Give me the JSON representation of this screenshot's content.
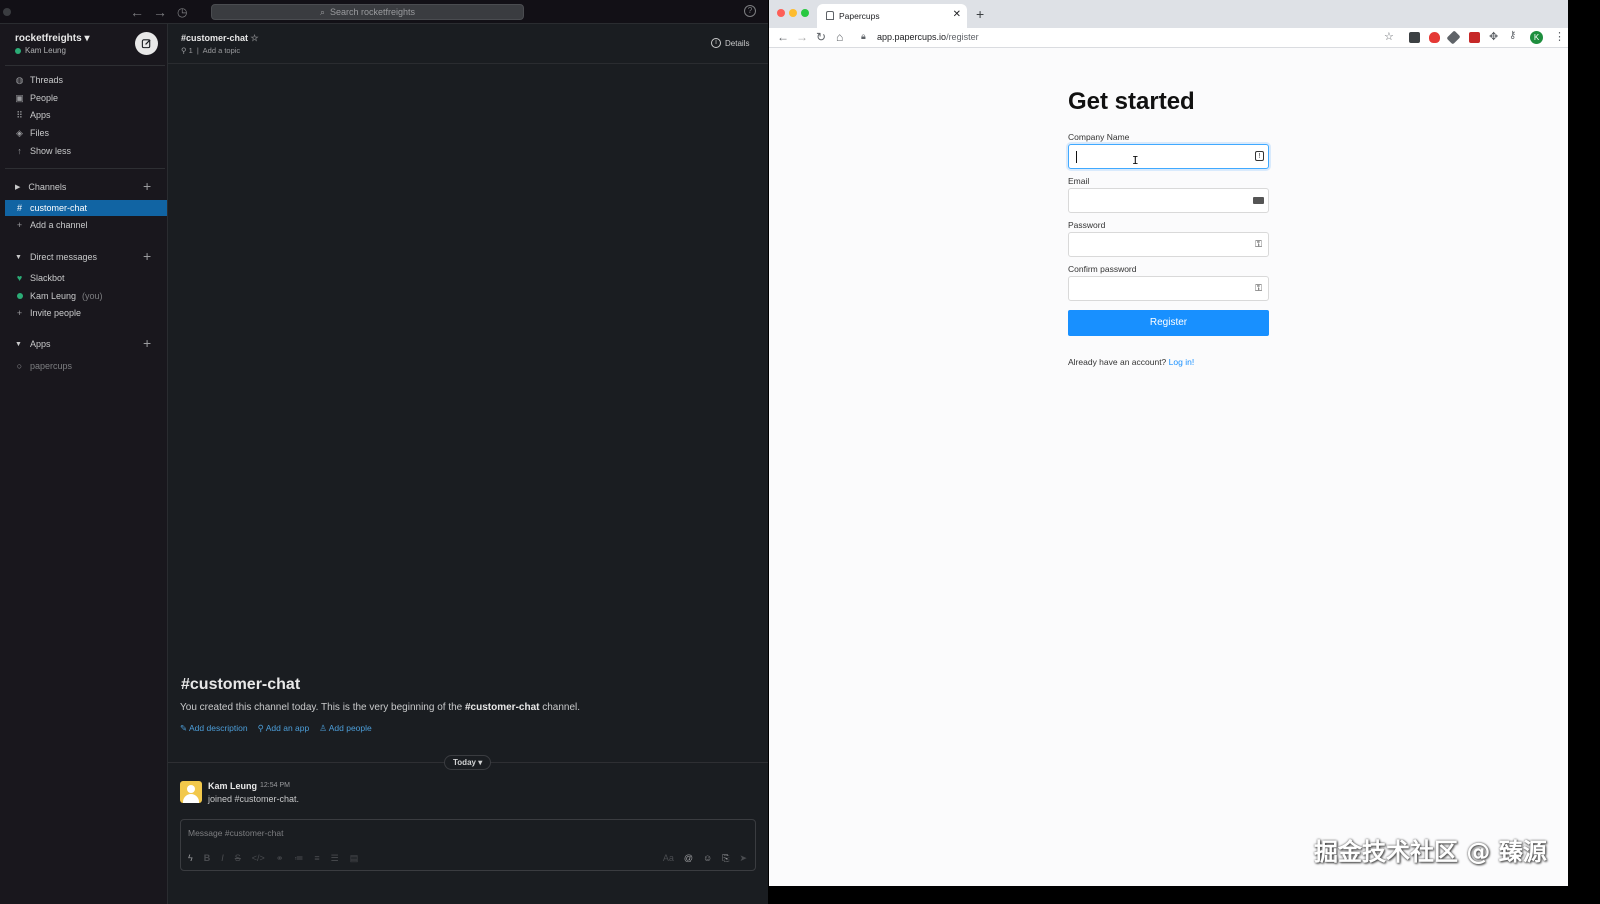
{
  "slack": {
    "search_placeholder": "Search rocketfreights",
    "help": "?",
    "workspace": {
      "name": "rocketfreights",
      "user": "Kam Leung"
    },
    "nav": [
      {
        "label": "Threads"
      },
      {
        "label": "People"
      },
      {
        "label": "Apps"
      },
      {
        "label": "Files"
      },
      {
        "label": "Show less"
      }
    ],
    "channels": {
      "title": "Channels",
      "items": [
        "customer-chat"
      ],
      "add": "Add a channel"
    },
    "direct_messages": {
      "title": "Direct messages",
      "items": [
        {
          "label": "Slackbot"
        },
        {
          "label": "Kam Leung",
          "suffix": "(you)"
        }
      ],
      "invite": "Invite people"
    },
    "apps_section": {
      "title": "Apps",
      "items": [
        "papercups"
      ]
    },
    "header": {
      "channel": "#customer-chat",
      "members": "1",
      "topic": "Add a topic",
      "details": "Details"
    },
    "intro": {
      "title": "#customer-chat",
      "text_before": "You created this channel today. This is the very beginning of the ",
      "text_channel": "#customer-chat",
      "text_after": " channel.",
      "links": [
        "Add description",
        "Add an app",
        "Add people"
      ]
    },
    "day_divider": "Today",
    "message": {
      "author": "Kam Leung",
      "time": "12:54 PM",
      "text": "joined #customer-chat."
    },
    "composer_placeholder": "Message #customer-chat",
    "composer_format": "Aa"
  },
  "browser": {
    "tab_title": "Papercups",
    "url_host": "app.papercups.io",
    "url_path": "/register",
    "profile_initial": "K",
    "colors": {
      "accent": "#1890ff",
      "slack_active": "#1164a3",
      "online": "#2bac76"
    }
  },
  "form": {
    "title": "Get started",
    "fields": [
      {
        "label": "Company Name",
        "value": ""
      },
      {
        "label": "Email",
        "value": ""
      },
      {
        "label": "Password",
        "value": ""
      },
      {
        "label": "Confirm password",
        "value": ""
      }
    ],
    "submit": "Register",
    "login_prompt": "Already have an account?",
    "login_link": "Log in!"
  },
  "watermark": "掘金技术社区 @ 臻源"
}
